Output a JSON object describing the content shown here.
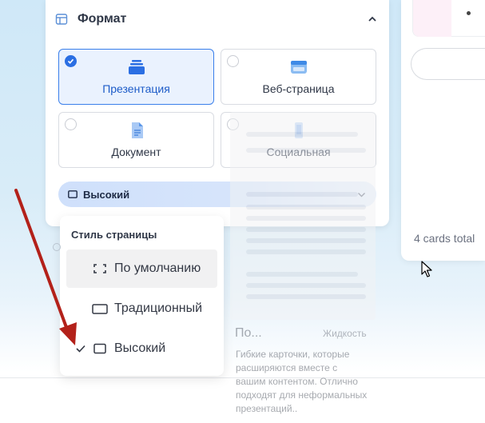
{
  "format_panel": {
    "title": "Формат",
    "options": [
      {
        "label": "Презентация",
        "selected": true,
        "icon": "stack-icon"
      },
      {
        "label": "Веб-страница",
        "selected": false,
        "icon": "browser-icon"
      },
      {
        "label": "Документ",
        "selected": false,
        "icon": "document-icon"
      },
      {
        "label": "Социальная",
        "selected": false,
        "icon": "phone-icon"
      }
    ],
    "dropdown": {
      "value": "Высокий"
    }
  },
  "page_style_menu": {
    "title": "Стиль страницы",
    "items": [
      {
        "label": "По умолчанию",
        "hovered": true,
        "checked": false,
        "icon": "expand-corners-icon"
      },
      {
        "label": "Традиционный",
        "hovered": false,
        "checked": false,
        "icon": "landscape-rect-icon"
      },
      {
        "label": "Высокий",
        "hovered": false,
        "checked": true,
        "icon": "tall-rect-icon"
      }
    ]
  },
  "preview_overlay": {
    "title": "По...",
    "tag": "Жидкость",
    "description": "Гибкие карточки, которые расширяются вместе с вашим контентом. Отлично подходят для неформальных презентаций.."
  },
  "right_panel": {
    "cards_total": "4 cards total"
  },
  "colors": {
    "accent": "#2b6fe3",
    "selected_bg": "#eaf2fe",
    "annotation_arrow": "#b3211a"
  }
}
